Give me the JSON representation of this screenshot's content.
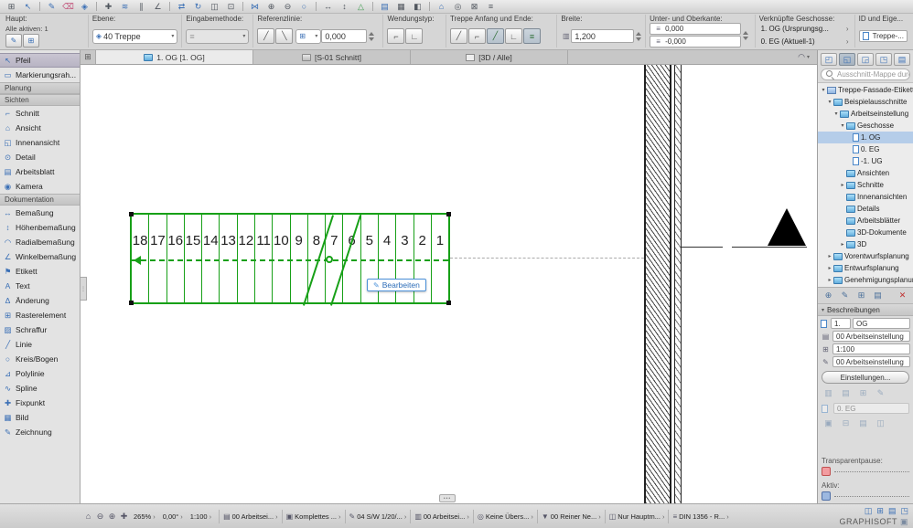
{
  "toolbar_row1": [
    {
      "g": "⊞",
      "c": "d",
      "n": "grid-icon"
    },
    {
      "g": "↖",
      "c": "b",
      "n": "select-icon"
    },
    {
      "g": "",
      "c": "sep"
    },
    {
      "g": "✎",
      "c": "b",
      "n": "pen-icon"
    },
    {
      "g": "⌫",
      "c": "p",
      "n": "eraser-icon"
    },
    {
      "g": "◈",
      "c": "b",
      "n": "layers-icon"
    },
    {
      "g": "",
      "c": "sep"
    },
    {
      "g": "✚",
      "c": "d",
      "n": "crosshair-icon"
    },
    {
      "g": "≋",
      "c": "b",
      "n": "guide-lines-icon"
    },
    {
      "g": "∥",
      "c": "d",
      "n": "parallel-icon"
    },
    {
      "g": "∠",
      "c": "d",
      "n": "angle-icon"
    },
    {
      "g": "",
      "c": "sep"
    },
    {
      "g": "⇄",
      "c": "b",
      "n": "move-icon"
    },
    {
      "g": "↻",
      "c": "b",
      "n": "rotate-icon"
    },
    {
      "g": "◫",
      "c": "d",
      "n": "mirror-icon"
    },
    {
      "g": "⊡",
      "c": "d",
      "n": "stretch-icon"
    },
    {
      "g": "",
      "c": "sep"
    },
    {
      "g": "⋈",
      "c": "b",
      "n": "intersect-icon"
    },
    {
      "g": "⊕",
      "c": "d",
      "n": "snap-icon"
    },
    {
      "g": "⊖",
      "c": "d",
      "n": "trim-icon"
    },
    {
      "g": "○",
      "c": "b",
      "n": "fillet-icon"
    },
    {
      "g": "",
      "c": "sep"
    },
    {
      "g": "↔",
      "c": "d",
      "n": "measure-icon"
    },
    {
      "g": "↕",
      "c": "d",
      "n": "elevation-icon"
    },
    {
      "g": "△",
      "c": "g",
      "n": "level-icon"
    },
    {
      "g": "",
      "c": "sep"
    },
    {
      "g": "▤",
      "c": "b",
      "n": "worksheet-icon"
    },
    {
      "g": "▦",
      "c": "d",
      "n": "hatch-icon"
    },
    {
      "g": "◧",
      "c": "d",
      "n": "zone-icon"
    },
    {
      "g": "",
      "c": "sep"
    },
    {
      "g": "⌂",
      "c": "b",
      "n": "home-story-icon"
    },
    {
      "g": "◎",
      "c": "d",
      "n": "target-icon"
    },
    {
      "g": "⊠",
      "c": "d",
      "n": "close-icon"
    },
    {
      "g": "≡",
      "c": "d",
      "n": "list-icon"
    }
  ],
  "controls": {
    "haupt_label": "Haupt:",
    "alle_aktiven": "Alle aktiven: 1",
    "haupt_icons": [
      {
        "g": "✎"
      },
      {
        "g": "⊞"
      }
    ],
    "ebene_label": "Ebene:",
    "ebene_icon": "◈",
    "ebene_value": "40 Treppe",
    "eingabe_label": "Eingabemethode:",
    "eingabe_icon": "≡",
    "referenz_label": "Referenzlinie:",
    "referenz_toggles": [
      {
        "g": "╱"
      },
      {
        "g": "╲"
      }
    ],
    "referenz_dd_icon": "⊞",
    "referenz_value": "0,000",
    "wendung_label": "Wendungstyp:",
    "wendung_toggles": [
      {
        "g": "⌐"
      },
      {
        "g": "∟"
      }
    ],
    "anfang_label": "Treppe Anfang und Ende:",
    "anfang_toggles": [
      {
        "g": "╱"
      },
      {
        "g": "⌐"
      },
      {
        "g": "╱",
        "cls": "on"
      },
      {
        "g": "∟"
      },
      {
        "g": "≡",
        "cls": "on"
      }
    ],
    "breite_label": "Breite:",
    "breite_icon": "▥",
    "breite_value": "1,200",
    "kante_label": "Unter- und Oberkante:",
    "kante_icon": "≡",
    "kante_value1": "0,000",
    "kante_value2": "-0,000",
    "geschosse_label": "Verknüpfte Geschosse:",
    "geschoss1": "1. OG (Ursprungsg...",
    "geschoss2": "0. EG (Aktuell-1)",
    "id_label": "ID und Eige...",
    "id_value": "Treppe-..."
  },
  "tabbar": {
    "grid_glyph": "⊞",
    "tabs": [
      {
        "icon": "folder",
        "label": "1. OG [1. OG]",
        "cls": "active"
      },
      {
        "icon": "folder",
        "label": "[S-01 Schnitt]"
      },
      {
        "icon": "box",
        "label": "[3D / Alle]"
      }
    ],
    "cloud_glyph": "◠"
  },
  "sidebar": {
    "items": [
      {
        "icon": "↖",
        "label": "Pfeil",
        "cls": "selected"
      },
      {
        "icon": "▭",
        "label": "Markierungsrah..."
      },
      {
        "label": "Planung",
        "cls": "header"
      },
      {
        "label": "Sichten",
        "cls": "header"
      },
      {
        "icon": "⌐",
        "label": "Schnitt"
      },
      {
        "icon": "⌂",
        "label": "Ansicht"
      },
      {
        "icon": "◱",
        "label": "Innenansicht"
      },
      {
        "icon": "⊙",
        "label": "Detail"
      },
      {
        "icon": "▤",
        "label": "Arbeitsblatt"
      },
      {
        "icon": "◉",
        "label": "Kamera"
      },
      {
        "label": "Dokumentation",
        "cls": "header"
      },
      {
        "icon": "↔",
        "label": "Bemaßung"
      },
      {
        "icon": "↕",
        "label": "Höhenbemaßung"
      },
      {
        "icon": "◠",
        "label": "Radialbemaßung"
      },
      {
        "icon": "∠",
        "label": "Winkelbemaßung"
      },
      {
        "icon": "⚑",
        "label": "Etikett"
      },
      {
        "icon": "A",
        "label": "Text"
      },
      {
        "icon": "Δ",
        "label": "Änderung"
      },
      {
        "icon": "⊞",
        "label": "Rasterelement"
      },
      {
        "icon": "▨",
        "label": "Schraffur"
      },
      {
        "icon": "╱",
        "label": "Linie"
      },
      {
        "icon": "○",
        "label": "Kreis/Bogen"
      },
      {
        "icon": "⊿",
        "label": "Polylinie"
      },
      {
        "icon": "∿",
        "label": "Spline"
      },
      {
        "icon": "✚",
        "label": "Fixpunkt"
      },
      {
        "icon": "▦",
        "label": "Bild"
      },
      {
        "icon": "✎",
        "label": "Zeichnung"
      }
    ]
  },
  "canvas": {
    "stair_numbers": [
      "18",
      "17",
      "16",
      "15",
      "14",
      "13",
      "12",
      "11",
      "10",
      "9",
      "8",
      "7",
      "6",
      "5",
      "4",
      "3",
      "2",
      "1"
    ],
    "edit_icon": "✎",
    "edit_button_label": "Bearbeiten"
  },
  "right_panel": {
    "view_icons": [
      {
        "g": "◰",
        "n": "project-map-icon"
      },
      {
        "g": "◱",
        "n": "view-map-icon",
        "cls": "on"
      },
      {
        "g": "◲",
        "n": "layout-book-icon"
      },
      {
        "g": "◳",
        "n": "publisher-icon"
      },
      {
        "g": "▤",
        "n": "pin-panel-icon"
      }
    ],
    "search_placeholder": "Ausschnitt-Mappe durchsuchen",
    "tree": [
      {
        "label": "Treppe-Fassade-Etikette",
        "pad": 2,
        "arrow": "▾",
        "icon": "book"
      },
      {
        "label": "Beispielausschnitte",
        "pad": 9,
        "arrow": "▾",
        "icon": "folder"
      },
      {
        "label": "Arbeitseinstellung",
        "pad": 16,
        "arrow": "▾",
        "icon": "folder"
      },
      {
        "label": "Geschosse",
        "pad": 23,
        "arrow": "▾",
        "icon": "folder"
      },
      {
        "label": "1. OG",
        "pad": 38,
        "icon": "page",
        "cls": "selected"
      },
      {
        "label": "0. EG",
        "pad": 38,
        "icon": "page"
      },
      {
        "label": "-1. UG",
        "pad": 38,
        "icon": "page"
      },
      {
        "label": "Ansichten",
        "pad": 31,
        "icon": "folder"
      },
      {
        "label": "Schnitte",
        "pad": 23,
        "arrow": "▸",
        "icon": "folder"
      },
      {
        "label": "Innenansichten",
        "pad": 31,
        "icon": "folder"
      },
      {
        "label": "Details",
        "pad": 31,
        "icon": "folder"
      },
      {
        "label": "Arbeitsblätter",
        "pad": 31,
        "icon": "folder"
      },
      {
        "label": "3D-Dokumente",
        "pad": 31,
        "icon": "folder"
      },
      {
        "label": "3D",
        "pad": 23,
        "arrow": "▸",
        "icon": "folder"
      },
      {
        "label": "Vorentwurfsplanung",
        "pad": 9,
        "arrow": "▸",
        "icon": "folder"
      },
      {
        "label": "Entwurfsplanung",
        "pad": 9,
        "arrow": "▸",
        "icon": "folder"
      },
      {
        "label": "Genehmigungsplanung",
        "pad": 9,
        "arrow": "▸",
        "icon": "folder"
      }
    ],
    "tool_icons": [
      {
        "g": "⊕",
        "n": "new-viewpoint-icon"
      },
      {
        "g": "✎",
        "n": "edit-viewpoint-icon"
      },
      {
        "g": "⊞",
        "n": "clone-folder-icon"
      },
      {
        "g": "▤",
        "n": "save-view-icon"
      },
      {
        "g": "✕",
        "n": "delete-icon",
        "c": "red"
      }
    ],
    "beschreibungen_label": "Beschreibungen",
    "field_num": "1.",
    "field_name": "OG",
    "field_setting1": "00 Arbeitseinstellung",
    "field_scale": "1:100",
    "field_setting2": "00 Arbeitseinstellung",
    "settings_button": "Einstellungen...",
    "disabled_icons1": [
      {
        "g": "▥"
      },
      {
        "g": "▤"
      },
      {
        "g": "⊞"
      },
      {
        "g": "✎"
      }
    ],
    "floor_value": "0. EG",
    "disabled_icons2": [
      {
        "g": "▣"
      },
      {
        "g": "⊟"
      },
      {
        "g": "▤"
      },
      {
        "g": "◫"
      }
    ],
    "transparent_label": "Transparentpause:",
    "aktiv_label": "Aktiv:"
  },
  "statusbar": {
    "nav_icons": [
      {
        "g": "⌂",
        "n": "fit-view-icon"
      },
      {
        "g": "⊖",
        "n": "zoom-out-icon"
      },
      {
        "g": "⊕",
        "n": "zoom-in-icon"
      },
      {
        "g": "✚",
        "n": "pan-icon"
      }
    ],
    "zoom": "265%",
    "angle": "0,00°",
    "scale": "1:100",
    "tabs": [
      {
        "icon": "▤",
        "label": "00 Arbeitsei..."
      },
      {
        "icon": "▣",
        "label": "Komplettes ..."
      },
      {
        "icon": "✎",
        "label": "04 S/W 1/20/..."
      },
      {
        "icon": "▥",
        "label": "00 Arbeitsei..."
      },
      {
        "icon": "◎",
        "label": "Keine Übers..."
      },
      {
        "icon": "▼",
        "label": "00 Reiner Ne..."
      },
      {
        "icon": "◫",
        "label": "Nur Hauptm..."
      },
      {
        "icon": "≡",
        "label": "DIN 1356 - R..."
      }
    ],
    "panel_icons": [
      {
        "g": "◫"
      },
      {
        "g": "⊞"
      },
      {
        "g": "▤"
      },
      {
        "g": "◳"
      }
    ],
    "brand": "GRAPHISOFT",
    "brand_icon": "▣"
  }
}
